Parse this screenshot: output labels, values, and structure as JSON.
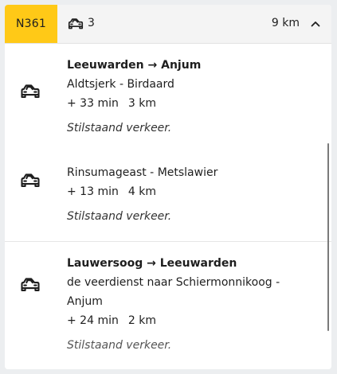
{
  "header": {
    "road": "N361",
    "incident_count": "3",
    "distance": "9 km",
    "car_icon": "car-icon",
    "toggle_icon": "chevron-up-icon"
  },
  "incidents": [
    {
      "route": "Leeuwarden → Anjum",
      "segment": "Aldtsjerk - Birdaard",
      "delay": "+ 33 min",
      "length": "3 km",
      "status": "Stilstaand verkeer."
    },
    {
      "route": "",
      "segment": "Rinsumageast - Metslawier",
      "delay": "+ 13 min",
      "length": "4 km",
      "status": "Stilstaand verkeer."
    },
    {
      "route": "Lauwersoog → Leeuwarden",
      "segment": "de veerdienst naar Schiermonnikoog - Anjum",
      "delay": "+ 24 min",
      "length": "2 km",
      "status": "Stilstaand verkeer."
    }
  ],
  "colors": {
    "road_badge": "#ffc917",
    "header_bg": "#f4f4f4",
    "card_bg": "#ffffff",
    "page_bg": "#eceef0"
  }
}
